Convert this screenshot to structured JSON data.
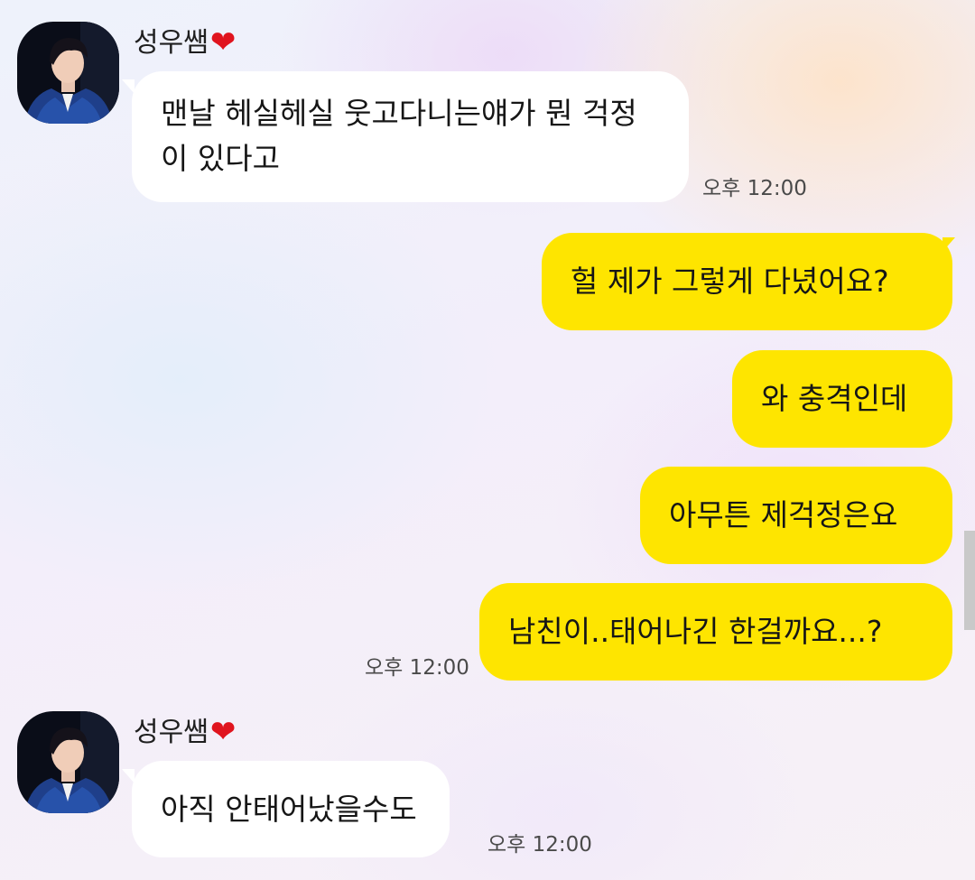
{
  "chat": {
    "sender_name": "성우쌤",
    "sender_heart": "❤",
    "avatar_icon": "profile-photo-dark-blue-portrait",
    "colors": {
      "incoming_bubble": "#ffffff",
      "outgoing_bubble": "#fee500",
      "heart": "#e0141e"
    },
    "messages": [
      {
        "from": "them",
        "text": "맨날 헤실헤실 웃고다니는얘가 뭔 걱정이 있다고",
        "time": "오후 12:00"
      },
      {
        "from": "me",
        "text": "헐 제가 그렇게 다녔어요?"
      },
      {
        "from": "me",
        "text": "와 충격인데"
      },
      {
        "from": "me",
        "text": "아무튼 제걱정은요"
      },
      {
        "from": "me",
        "text": "남친이..태어나긴 한걸까요...?",
        "time": "오후 12:00"
      },
      {
        "from": "them",
        "text": "아직 안태어났을수도",
        "time": "오후 12:00"
      }
    ]
  }
}
